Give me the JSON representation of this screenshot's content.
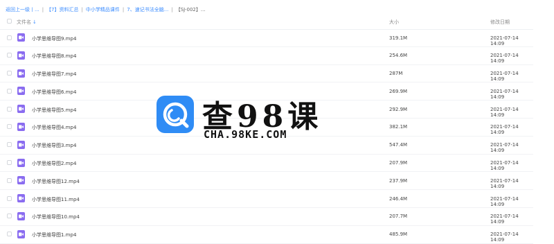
{
  "breadcrumb": [
    {
      "label": "返回上一级丨..."
    },
    {
      "label": "【7】资料汇总"
    },
    {
      "label": "中小学精品课件"
    },
    {
      "label": "7、速记书法全脑..."
    },
    {
      "label": "【SJ-002】..."
    }
  ],
  "breadcrumb_separator": "|",
  "header": {
    "name": "文件名",
    "sort_arrow": "↓",
    "size": "大小",
    "date": "修改日期"
  },
  "files": [
    {
      "name": "小学思维导图9.mp4",
      "size": "319.1M",
      "date": "2021-07-14 14:09"
    },
    {
      "name": "小学思维导图8.mp4",
      "size": "254.6M",
      "date": "2021-07-14 14:09"
    },
    {
      "name": "小学思维导图7.mp4",
      "size": "287M",
      "date": "2021-07-14 14:09"
    },
    {
      "name": "小学思维导图6.mp4",
      "size": "269.9M",
      "date": "2021-07-14 14:09"
    },
    {
      "name": "小学思维导图5.mp4",
      "size": "292.9M",
      "date": "2021-07-14 14:09"
    },
    {
      "name": "小学思维导图4.mp4",
      "size": "382.1M",
      "date": "2021-07-14 14:09"
    },
    {
      "name": "小学思维导图3.mp4",
      "size": "547.4M",
      "date": "2021-07-14 14:09"
    },
    {
      "name": "小学思维导图2.mp4",
      "size": "207.9M",
      "date": "2021-07-14 14:09"
    },
    {
      "name": "小学思维导图12.mp4",
      "size": "237.9M",
      "date": "2021-07-14 14:09"
    },
    {
      "name": "小学思维导图11.mp4",
      "size": "246.4M",
      "date": "2021-07-14 14:09"
    },
    {
      "name": "小学思维导图10.mp4",
      "size": "207.7M",
      "date": "2021-07-14 14:09"
    },
    {
      "name": "小学思维导图1.mp4",
      "size": "485.9M",
      "date": "2021-07-14 14:09"
    }
  ],
  "file_icon": "video-file-icon",
  "watermark": {
    "title": "查98课",
    "subtitle": "CHA.98KE.COM",
    "logo_icon": "magnifier-logo-icon"
  },
  "colors": {
    "link": "#3b8cff",
    "video_icon": "#8a6cf0",
    "logo": "#2f8cf5"
  }
}
